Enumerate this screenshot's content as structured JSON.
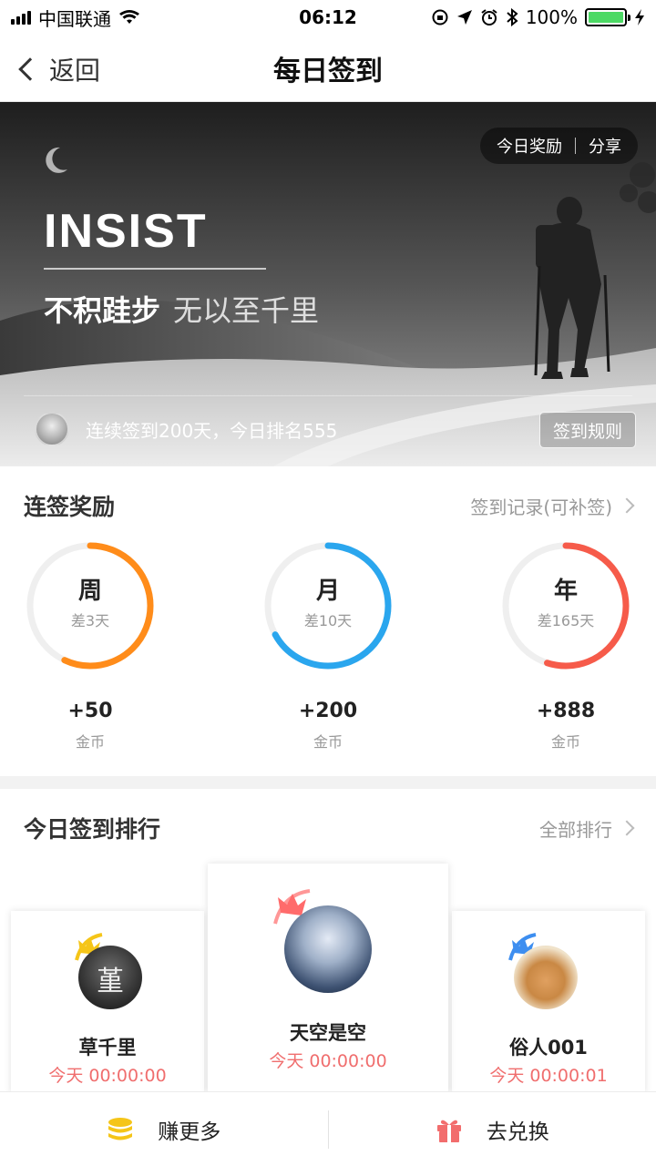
{
  "status_bar": {
    "carrier": "中国联通",
    "time": "06:12",
    "battery": "100%",
    "battery_level": 1.0
  },
  "nav": {
    "back_label": "返回",
    "title": "每日签到"
  },
  "banner": {
    "today_reward": "今日奖励",
    "share": "分享",
    "headline": "INSIST",
    "motto_part1": "不积跬步",
    "motto_part2": "无以至千里",
    "checkin_status": "连续签到200天，今日排名555",
    "rules_button": "签到规则"
  },
  "streak": {
    "title": "连签奖励",
    "records_link": "签到记录(可补签)",
    "items": [
      {
        "label": "周",
        "remaining": "差3天",
        "reward": "+50",
        "unit": "金币",
        "color": "#ff8c1a",
        "progress": 0.57
      },
      {
        "label": "月",
        "remaining": "差10天",
        "reward": "+200",
        "unit": "金币",
        "color": "#2aa6ee",
        "progress": 0.67
      },
      {
        "label": "年",
        "remaining": "差165天",
        "reward": "+888",
        "unit": "金币",
        "color": "#f65b4a",
        "progress": 0.55
      }
    ]
  },
  "ranking": {
    "title": "今日签到排行",
    "all_link": "全部排行",
    "first": {
      "name": "天空是空",
      "time": "今天 00:00:00",
      "crown_color": "#ff6b6b"
    },
    "second": {
      "name": "草千里",
      "time": "今天 00:00:00",
      "crown_color": "#f5c518",
      "avatar_text": "堇"
    },
    "third": {
      "name": "俗人001",
      "time": "今天 00:00:01",
      "crown_color": "#3d8ef0"
    }
  },
  "bottom_bar": {
    "earn_more": "赚更多",
    "exchange": "去兑换"
  }
}
